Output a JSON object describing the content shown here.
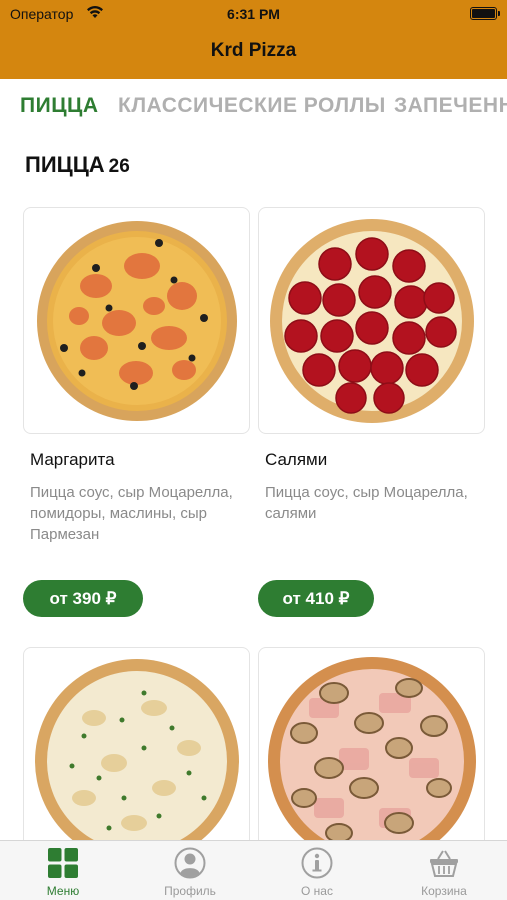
{
  "status_bar": {
    "carrier": "Оператор",
    "time": "6:31 PM"
  },
  "app": {
    "title": "Krd Pizza",
    "header_color": "#d4860f",
    "accent_color": "#2e7d32"
  },
  "tabs": [
    {
      "label": "ПИЦЦА",
      "active": true
    },
    {
      "label": "КЛАССИЧЕСКИЕ РОЛЛЫ",
      "active": false
    },
    {
      "label": "ЗАПЕЧЕННЫЕ",
      "active": false
    }
  ],
  "section": {
    "title": "ПИЦЦА",
    "count": "26"
  },
  "products": [
    {
      "name": "Маргарита",
      "description": "Пицца соус, сыр Моцарелла, помидоры, маслины, сыр Пармезан",
      "price": "от 390 ₽",
      "image_icon": "pizza-margherita"
    },
    {
      "name": "Салями",
      "description": "Пицца соус, сыр Моцарелла, салями",
      "price": "от 410 ₽",
      "image_icon": "pizza-salami"
    },
    {
      "image_icon": "pizza-chicken-mushroom"
    },
    {
      "image_icon": "pizza-ham-mushroom"
    }
  ],
  "bottom_nav": [
    {
      "label": "Меню",
      "icon": "grid-icon",
      "active": true
    },
    {
      "label": "Профиль",
      "icon": "profile-icon",
      "active": false
    },
    {
      "label": "О нас",
      "icon": "info-icon",
      "active": false
    },
    {
      "label": "Корзина",
      "icon": "basket-icon",
      "active": false
    }
  ]
}
